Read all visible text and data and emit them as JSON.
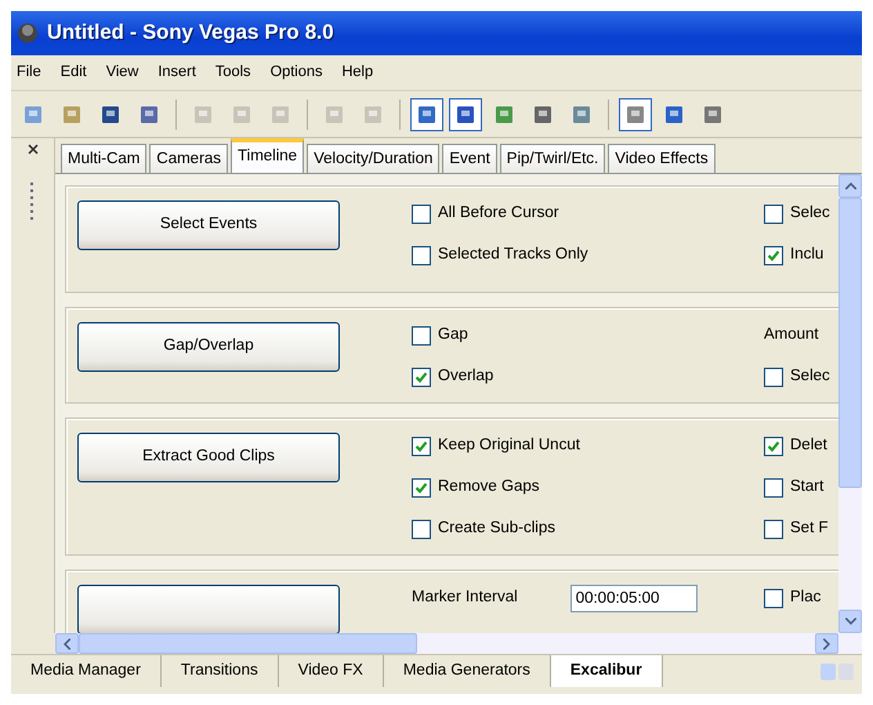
{
  "window": {
    "title": "Untitled - Sony Vegas Pro 8.0"
  },
  "menu": [
    "File",
    "Edit",
    "View",
    "Insert",
    "Tools",
    "Options",
    "Help"
  ],
  "toolbar": [
    {
      "pressed": false
    },
    {
      "pressed": false
    },
    {
      "pressed": false
    },
    {
      "pressed": false
    },
    {
      "kind": "separator"
    },
    {
      "pressed": false,
      "disabled": true
    },
    {
      "pressed": false,
      "disabled": true
    },
    {
      "pressed": false,
      "disabled": true
    },
    {
      "kind": "separator"
    },
    {
      "pressed": false,
      "disabled": true
    },
    {
      "pressed": false,
      "disabled": true
    },
    {
      "kind": "separator"
    },
    {
      "pressed": true
    },
    {
      "pressed": true
    },
    {
      "pressed": false
    },
    {
      "pressed": false
    },
    {
      "pressed": false
    },
    {
      "kind": "separator"
    },
    {
      "pressed": true
    },
    {
      "pressed": false
    },
    {
      "pressed": false
    }
  ],
  "tabs": [
    {
      "label": "Multi-Cam",
      "selected": false
    },
    {
      "label": "Cameras",
      "selected": false
    },
    {
      "label": "Timeline",
      "selected": true
    },
    {
      "label": "Velocity/Duration",
      "selected": false
    },
    {
      "label": "Event",
      "selected": false
    },
    {
      "label": "Pip/Twirl/Etc.",
      "selected": false
    },
    {
      "label": "Video Effects",
      "selected": false
    }
  ],
  "sections": [
    {
      "button": "Select Events",
      "options": [
        {
          "kind": "checkbox",
          "label": "All Before Cursor",
          "checked": false
        },
        {
          "kind": "checkbox",
          "label": "Selected Tracks Only",
          "checked": false
        }
      ],
      "extra": [
        {
          "kind": "checkbox",
          "label": "Selec",
          "checked": false
        },
        {
          "kind": "checkbox",
          "label": "Inclu",
          "checked": true
        }
      ]
    },
    {
      "button": "Gap/Overlap",
      "options": [
        {
          "kind": "checkbox",
          "label": "Gap",
          "checked": false
        },
        {
          "kind": "checkbox",
          "label": "Overlap",
          "checked": true
        }
      ],
      "extra": [
        {
          "kind": "label",
          "label": "Amount"
        },
        {
          "kind": "checkbox",
          "label": "Selec",
          "checked": false
        }
      ]
    },
    {
      "button": "Extract Good Clips",
      "options": [
        {
          "kind": "checkbox",
          "label": "Keep Original Uncut",
          "checked": true
        },
        {
          "kind": "checkbox",
          "label": "Remove Gaps",
          "checked": true
        },
        {
          "kind": "checkbox",
          "label": "Create Sub-clips",
          "checked": false
        }
      ],
      "extra": [
        {
          "kind": "checkbox",
          "label": "Delet",
          "checked": true
        },
        {
          "kind": "checkbox",
          "label": "Start",
          "checked": false
        },
        {
          "kind": "checkbox",
          "label": "Set F",
          "checked": false
        }
      ]
    },
    {
      "options": [
        {
          "kind": "field",
          "label": "Marker Interval",
          "value": "00:00:05:00"
        }
      ],
      "extra": [
        {
          "kind": "checkbox",
          "label": "Plac",
          "checked": false
        }
      ]
    }
  ],
  "bottom_tabs": [
    {
      "label": "Media Manager",
      "selected": false
    },
    {
      "label": "Transitions",
      "selected": false
    },
    {
      "label": "Video FX",
      "selected": false
    },
    {
      "label": "Media Generators",
      "selected": false
    },
    {
      "label": "Excalibur",
      "selected": true
    }
  ]
}
